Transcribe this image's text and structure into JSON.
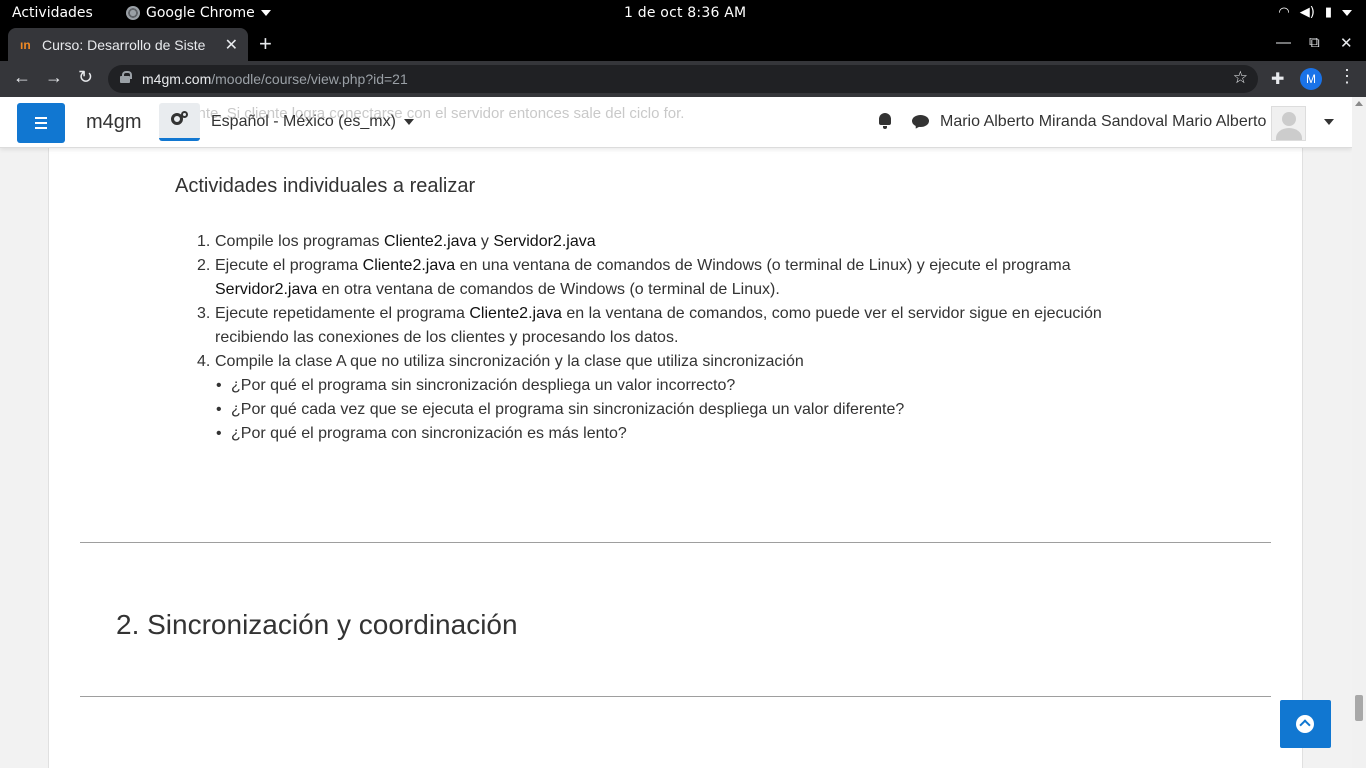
{
  "system_bar": {
    "activities": "Actividades",
    "app_name": "Google Chrome",
    "clock": "1 de oct   8:36 AM"
  },
  "browser": {
    "tab_title": "Curso: Desarrollo de Siste",
    "url_host": "m4gm.com",
    "url_path": "/moodle/course/view.php?id=21",
    "profile_initial": "M"
  },
  "navbar": {
    "brand": "m4gm",
    "language": "Español - México (es_mx)",
    "username": "Mario Alberto Miranda Sandoval Mario Alberto",
    "ghost_text": "cliente. Si cliente logra conectarse con el servidor entonces sale del ciclo for."
  },
  "content": {
    "heading": "Actividades individuales a realizar",
    "items": {
      "i1": {
        "n": "1.",
        "a": "Compile los programas ",
        "c1": "Cliente2.java",
        "b": " y ",
        "c2": "Servidor2.java"
      },
      "i2": {
        "n": "2.",
        "a": "Ejecute el programa ",
        "c1": "Cliente2.java",
        "b": " en una ventana de comandos de Windows (o terminal de Linux) y ejecute el programa",
        "c2": "Servidor2.java",
        "c": " en otra ventana de comandos de Windows (o terminal de Linux)."
      },
      "i3": {
        "n": "3.",
        "a": "Ejecute repetidamente el programa ",
        "c1": "Cliente2.java",
        "b": " en la ventana de comandos, como puede ver el servidor sigue en ejecución",
        "c": "recibiendo las conexiones de los clientes y procesando los datos."
      },
      "i4": {
        "n": "4.",
        "a": "Compile la clase A que no utiliza sincronización y la clase que utiliza sincronización"
      }
    },
    "questions": [
      "¿Por qué el programa sin sincronización despliega un valor incorrecto?",
      "¿Por qué cada vez que se ejecuta el programa sin sincronización despliega un valor diferente?",
      "¿Por qué el programa con sincronización es más lento?"
    ],
    "section_title": "2. Sincronización y coordinación"
  },
  "colors": {
    "primary": "#1177d1",
    "text": "#333333"
  }
}
